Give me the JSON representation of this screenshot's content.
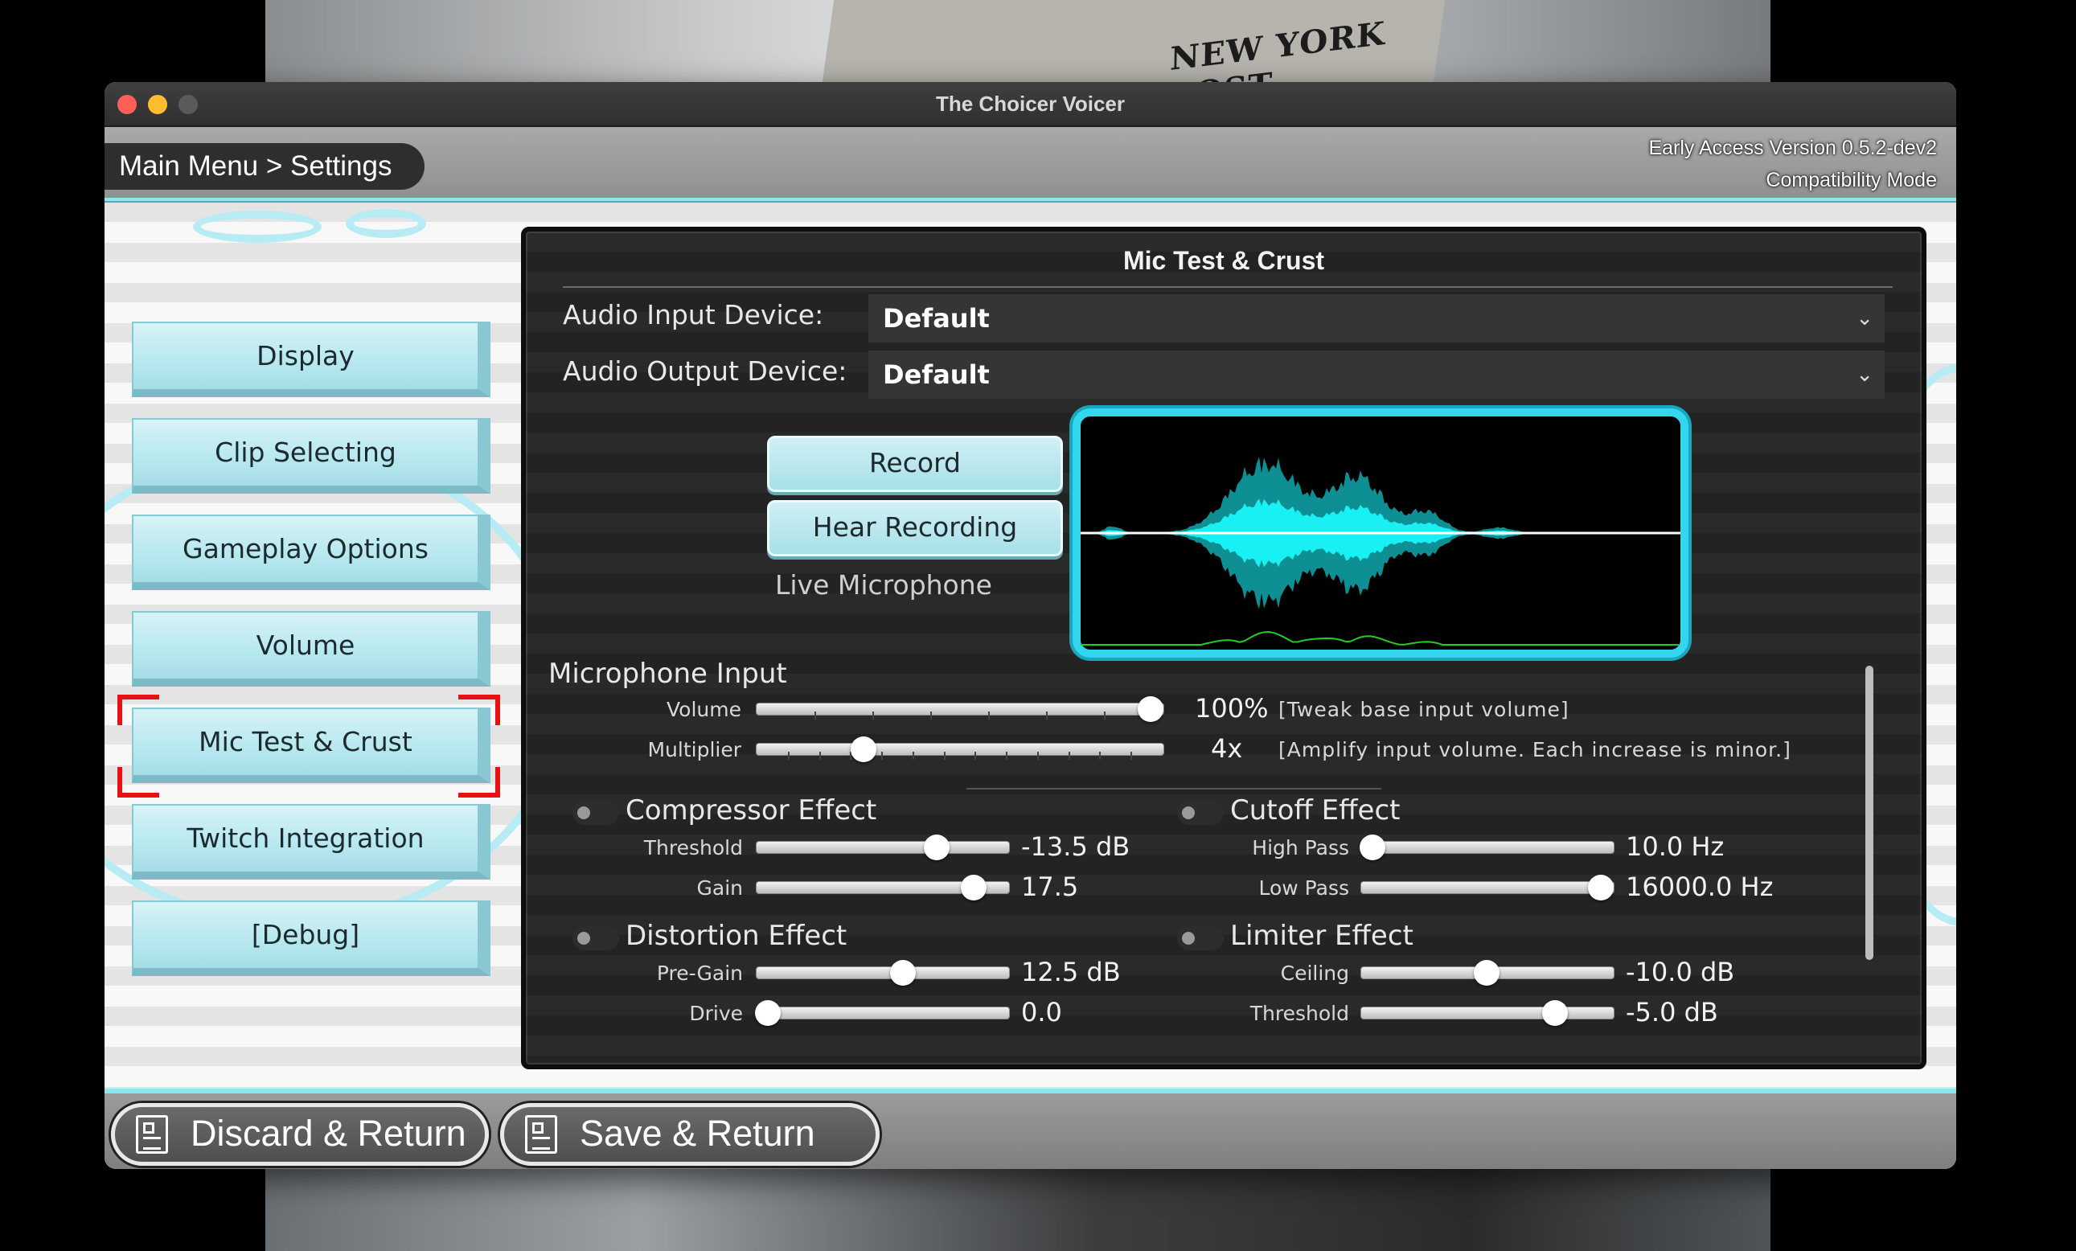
{
  "window": {
    "title": "The Choicer Voicer"
  },
  "header": {
    "breadcrumb": "Main Menu > Settings",
    "version_line1": "Early Access Version 0.5.2-dev2",
    "version_line2": "Compatibility Mode"
  },
  "background": {
    "newspaper_text": "NEW YORK POST"
  },
  "sidebar": {
    "items": [
      {
        "label": "Display"
      },
      {
        "label": "Clip Selecting"
      },
      {
        "label": "Gameplay Options"
      },
      {
        "label": "Volume"
      },
      {
        "label": "Mic Test & Crust",
        "selected": true
      },
      {
        "label": "Twitch Integration"
      },
      {
        "label": "[Debug]"
      }
    ]
  },
  "panel": {
    "title": "Mic Test & Crust",
    "audio_input": {
      "label": "Audio Input Device:",
      "value": "Default"
    },
    "audio_output": {
      "label": "Audio Output Device:",
      "value": "Default"
    },
    "record_label": "Record",
    "hear_label": "Hear Recording",
    "live_mic_label": "Live Microphone",
    "live_mic_on": false,
    "mic_input": {
      "title": "Microphone Input",
      "volume": {
        "label": "Volume",
        "value": "100%",
        "note": "[Tweak base input volume]",
        "fraction": 1.0
      },
      "multiplier": {
        "label": "Multiplier",
        "value": "4x",
        "note": "[Amplify input volume. Each increase is minor.]",
        "fraction": 0.25
      }
    },
    "compressor": {
      "title": "Compressor Effect",
      "enabled": false,
      "threshold": {
        "label": "Threshold",
        "value": "-13.5 dB",
        "fraction": 0.74
      },
      "gain": {
        "label": "Gain",
        "value": "17.5",
        "fraction": 0.9
      }
    },
    "cutoff": {
      "title": "Cutoff Effect",
      "enabled": false,
      "high_pass": {
        "label": "High Pass",
        "value": "10.0 Hz",
        "fraction": 0.0
      },
      "low_pass": {
        "label": "Low Pass",
        "value": "16000.0 Hz",
        "fraction": 1.0
      }
    },
    "distortion": {
      "title": "Distortion Effect",
      "enabled": false,
      "pre_gain": {
        "label": "Pre-Gain",
        "value": "12.5 dB",
        "fraction": 0.59
      },
      "drive": {
        "label": "Drive",
        "value": "0.0",
        "fraction": 0.0
      }
    },
    "limiter": {
      "title": "Limiter Effect",
      "enabled": false,
      "ceiling": {
        "label": "Ceiling",
        "value": "-10.0 dB",
        "fraction": 0.5
      },
      "threshold": {
        "label": "Threshold",
        "value": "-5.0 dB",
        "fraction": 0.8
      }
    }
  },
  "footer": {
    "discard_label": "Discard & Return",
    "save_label": "Save & Return"
  },
  "colors": {
    "accent_cyan": "#33d6ee",
    "selection_bracket": "#e81010",
    "waveform_outer": "#0e8f93",
    "waveform_inner": "#19f0f4",
    "waveform_peaks": "#22cc22"
  }
}
